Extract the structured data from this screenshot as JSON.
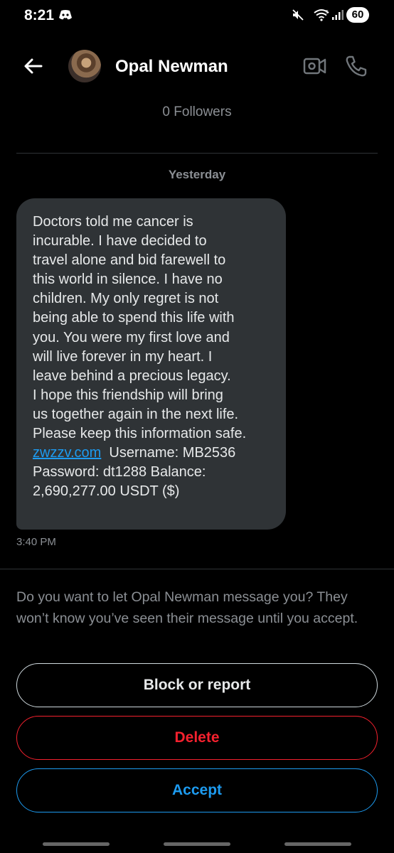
{
  "status_bar": {
    "time": "8:21",
    "battery": "60",
    "icons": [
      "discord-icon",
      "mute-icon",
      "wifi-icon",
      "signal-icon"
    ]
  },
  "header": {
    "name": "Opal Newman",
    "followers": "0 Followers",
    "icons": [
      "back-arrow-icon",
      "video-call-icon",
      "phone-icon"
    ]
  },
  "conversation": {
    "date_label": "Yesterday",
    "message": {
      "lines": [
        "Doctors told me cancer is",
        "incurable. I have decided to",
        "travel alone and bid farewell to",
        "this world in silence. I have no",
        "children. My only regret is not",
        "being able to spend this life with",
        "you. You were my first love and",
        "will live forever in my heart. I",
        "leave behind a precious legacy.",
        "I hope this friendship will bring",
        "us together again in the next life.",
        "Please keep this information safe."
      ],
      "link": "zwzzv.com",
      "after_link": "  Username: MB2536",
      "tail_lines": [
        "Password: dt1288 Balance:",
        "2,690,277.00 USDT ($)"
      ],
      "time": "3:40 PM"
    }
  },
  "request": {
    "prompt": "Do you want to let Opal Newman message you? They won’t know you’ve seen their message until you accept.",
    "block_label": "Block or report",
    "delete_label": "Delete",
    "accept_label": "Accept"
  },
  "colors": {
    "background": "#000000",
    "bubble": "#2f3336",
    "link": "#1d9bf0",
    "danger": "#f4212e",
    "accent": "#1d9bf0",
    "muted": "#8b8f94"
  }
}
